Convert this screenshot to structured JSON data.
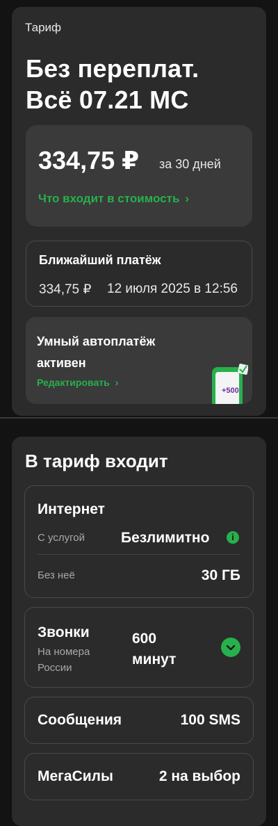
{
  "colors": {
    "accent": "#27b04c",
    "card": "#2b2b2b",
    "inner": "#3a3a3a",
    "background": "#131313"
  },
  "tariff": {
    "label": "Тариф",
    "name_line1": "Без переплат.",
    "name_line2": "Всё 07.21 МС",
    "price": "334,75 ₽",
    "period": "за 30 дней",
    "details_link": "Что входит в стоимость"
  },
  "next_payment": {
    "title": "Ближайший платёж",
    "amount": "334,75 ₽",
    "date": "12 июля 2025 в 12:56"
  },
  "autopay": {
    "title": "Умный автоплатёж активен",
    "edit_link": "Редактировать",
    "promo_badge": "+500"
  },
  "included": {
    "title": "В тариф входит",
    "internet": {
      "title": "Интернет",
      "with_service_label": "С услугой",
      "with_service_value": "Безлимитно",
      "without_label": "Без неё",
      "without_value": "30 ГБ"
    },
    "calls": {
      "title": "Звонки",
      "subtitle": "На номера России",
      "value": "600 минут"
    },
    "sms": {
      "title": "Сообщения",
      "value": "100 SMS"
    },
    "megasily": {
      "title": "МегаСилы",
      "value": "2 на выбор"
    }
  },
  "icons": [
    "chevron-right-icon",
    "info-icon",
    "chevron-down-icon",
    "phone-promo-icon"
  ]
}
